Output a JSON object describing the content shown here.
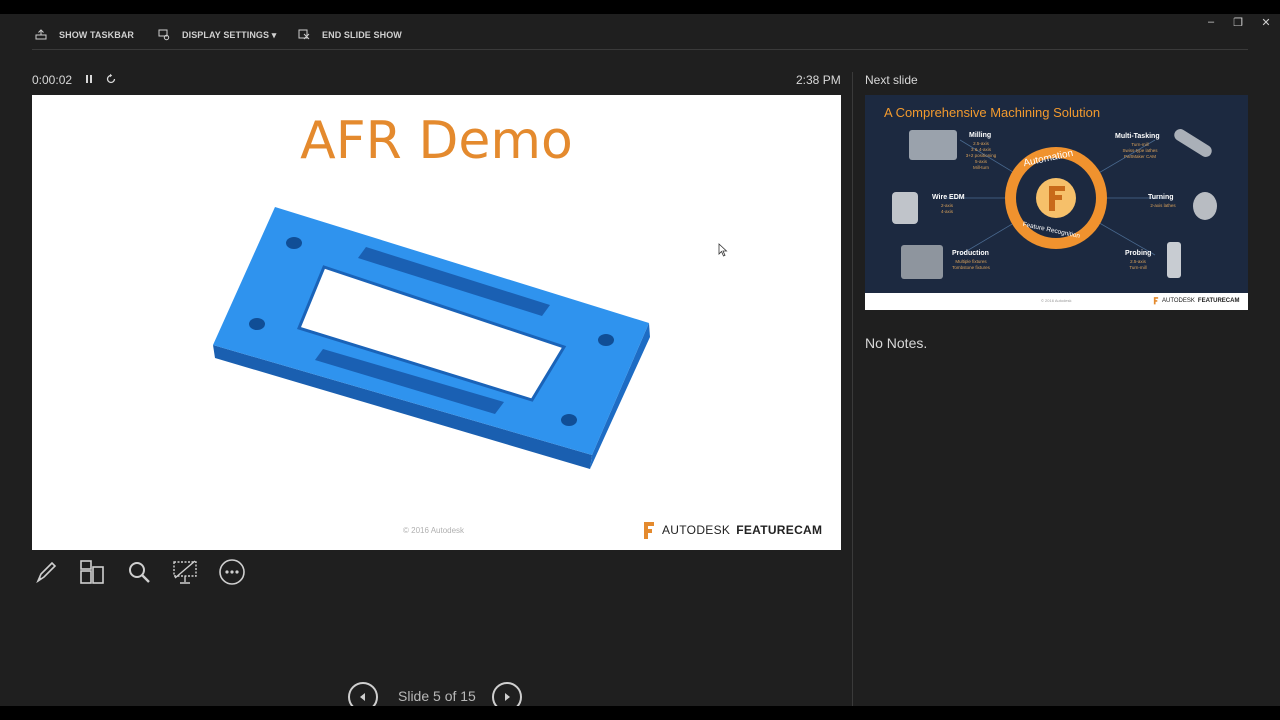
{
  "toolbar": {
    "show_taskbar": "SHOW TASKBAR",
    "display_settings": "DISPLAY SETTINGS ▾",
    "end_slide_show": "END SLIDE SHOW"
  },
  "window_controls": {
    "minimize": "–",
    "restore": "❐",
    "close": "✕"
  },
  "status": {
    "timer": "0:00:02",
    "clock": "2:38 PM"
  },
  "current_slide": {
    "title": "AFR Demo",
    "copyright": "© 2016 Autodesk",
    "brand_light": "AUTODESK",
    "brand_bold": "FEATURECAM"
  },
  "next_slide": {
    "header": "Next slide",
    "title": "A Comprehensive Machining Solution",
    "ring_top": "Automation",
    "ring_bottom": "Feature Recognition",
    "labels": {
      "milling": "Milling",
      "milling_sub": "2.5-axis\n3 & 4-axis\n3+2 positioning\n5-axis\nMill-turn",
      "multitasking": "Multi-Tasking",
      "multitasking_sub": "Turn-mill\nSwiss-type lathes\nPartMaker CAM",
      "wire_edm": "Wire EDM",
      "wire_edm_sub": "2-axis\n4-axis",
      "turning": "Turning",
      "turning_sub": "2-axis lathes",
      "production": "Production",
      "production_sub": "Multiple fixtures\nTombstone fixtures",
      "probing": "Probing",
      "probing_sub": "2.5-axis\nTurn-mill"
    },
    "footer_copy": "© 2016 Autodesk",
    "brand_light": "AUTODESK",
    "brand_bold": "FEATURECAM"
  },
  "notes": "No Notes.",
  "navigation": {
    "slide_indicator": "Slide 5 of 15"
  },
  "colors": {
    "accent_orange": "#e48a2e",
    "part_blue": "#2b8fe8",
    "thumb_bg": "#1c2940"
  },
  "icons": [
    "pen-icon",
    "slides-grid-icon",
    "zoom-icon",
    "black-screen-icon",
    "more-options-icon",
    "prev-slide-icon",
    "next-slide-icon"
  ]
}
